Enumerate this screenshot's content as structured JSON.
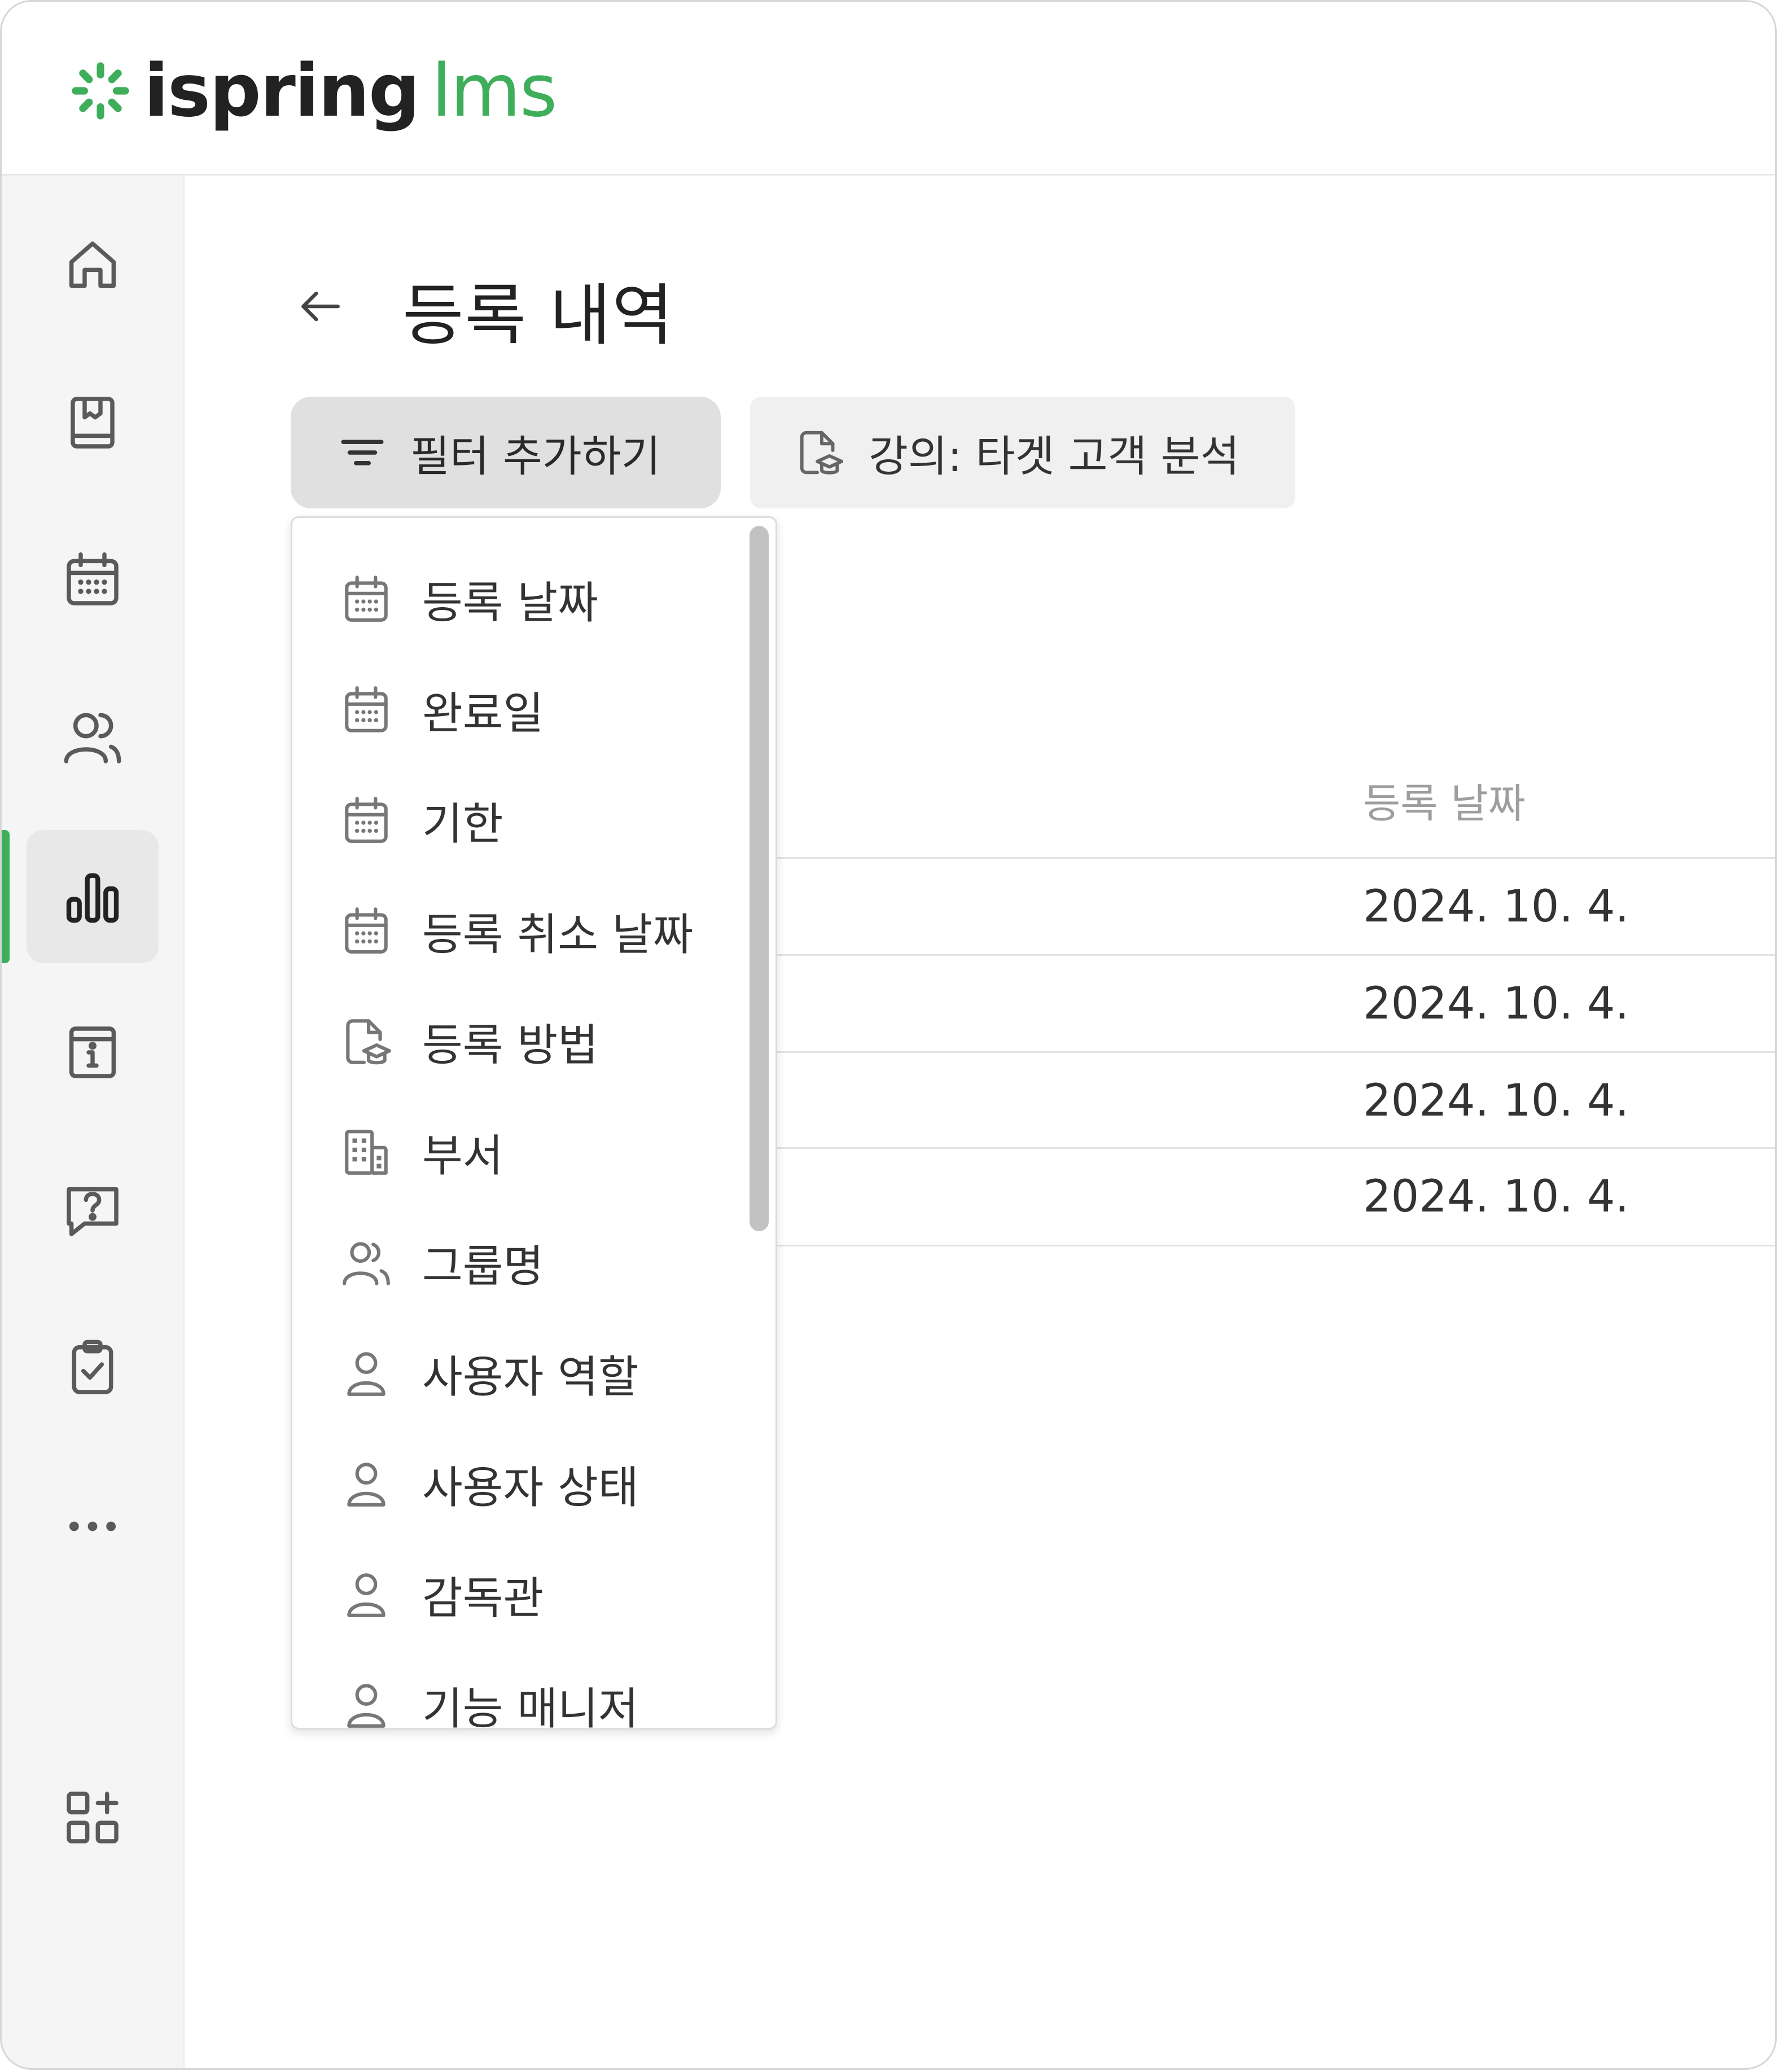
{
  "brand": {
    "word1": "ispring",
    "word2": "lms",
    "accent": "#3fae5a"
  },
  "sidebar": {
    "items": [
      {
        "name": "home",
        "icon": "home-icon"
      },
      {
        "name": "courses",
        "icon": "book-icon"
      },
      {
        "name": "calendar",
        "icon": "calendar-icon"
      },
      {
        "name": "users",
        "icon": "users-icon"
      },
      {
        "name": "reports",
        "icon": "bar-chart-icon",
        "active": true
      },
      {
        "name": "info",
        "icon": "info-icon"
      },
      {
        "name": "help",
        "icon": "help-icon"
      },
      {
        "name": "tasks",
        "icon": "clipboard-check-icon"
      },
      {
        "name": "more",
        "icon": "more-icon"
      },
      {
        "name": "add-widget",
        "icon": "add-widget-icon"
      }
    ]
  },
  "page": {
    "title": "등록 내역"
  },
  "toolbar": {
    "filter_label": "필터 추가하기",
    "course_chip_label": "강의: 타겟 고객 분석"
  },
  "table": {
    "column_header": "등록 날짜",
    "rows": [
      "2024. 10. 4.",
      "2024. 10. 4.",
      "2024. 10. 4.",
      "2024. 10. 4."
    ]
  },
  "dropdown": {
    "items": [
      {
        "label": "등록 날짜",
        "icon": "calendar-icon"
      },
      {
        "label": "완료일",
        "icon": "calendar-icon"
      },
      {
        "label": "기한",
        "icon": "calendar-icon"
      },
      {
        "label": "등록 취소 날짜",
        "icon": "calendar-icon"
      },
      {
        "label": "등록 방법",
        "icon": "course-file-icon"
      },
      {
        "label": "부서",
        "icon": "building-icon"
      },
      {
        "label": "그룹명",
        "icon": "users-icon"
      },
      {
        "label": "사용자 역할",
        "icon": "user-icon"
      },
      {
        "label": "사용자 상태",
        "icon": "user-icon"
      },
      {
        "label": "감독관",
        "icon": "user-icon"
      },
      {
        "label": "기능 매니저",
        "icon": "user-icon"
      }
    ]
  }
}
